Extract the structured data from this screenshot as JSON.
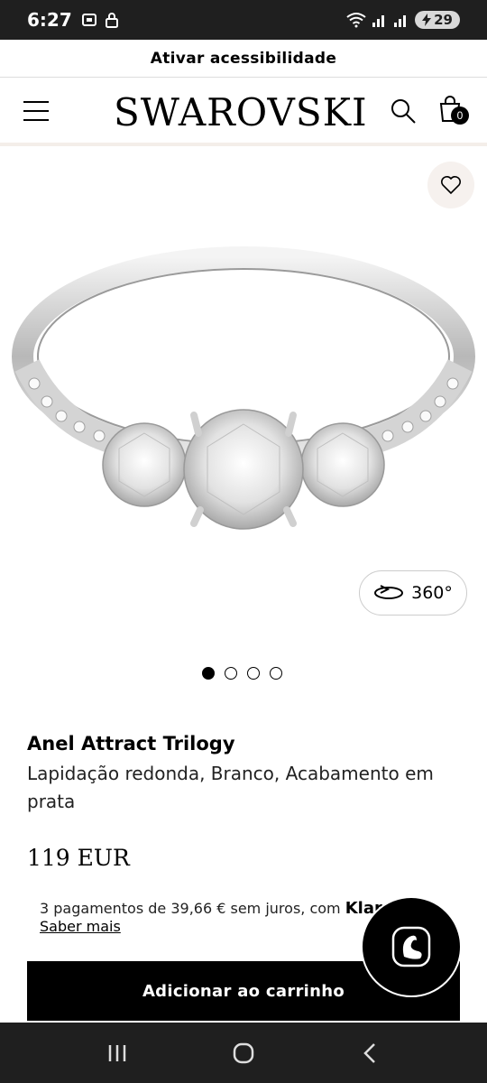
{
  "status": {
    "time": "6:27",
    "battery": "29"
  },
  "accessibility": {
    "label": "Ativar acessibilidade"
  },
  "header": {
    "logo": "SWAROVSKI",
    "cart_count": "0"
  },
  "gallery": {
    "btn_360_label": "360°",
    "slide_count": 4,
    "active_slide": 1
  },
  "product": {
    "name": "Anel Attract Trilogy",
    "description": "Lapidação redonda, Branco, Acabamento em prata",
    "price": "119 EUR"
  },
  "financing": {
    "text": "3 pagamentos de 39,66 € sem juros, com ",
    "provider": "Klarna",
    "learn_more": "Saber mais"
  },
  "cta": {
    "add_to_cart": "Adicionar ao carrinho"
  },
  "icons": [
    "menu-icon",
    "search-icon",
    "bag-icon",
    "heart-icon",
    "rotate-360-icon",
    "swan-chat-icon"
  ],
  "colors": {
    "accent": "#000000",
    "wishlist_bg": "#f6f1ee",
    "divider": "#f4eee9"
  }
}
